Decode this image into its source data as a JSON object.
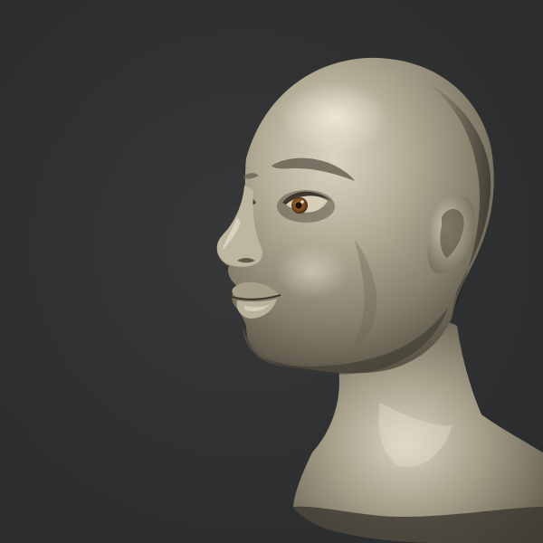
{
  "scene": {
    "subject": "sculpted-head-render",
    "colors": {
      "background": "#2e2f31",
      "skin_base": "#a49d88",
      "skin_highlight": "#e4dfcf",
      "skin_shadow": "#4f4a3f",
      "iris": "#7a4a1e",
      "pupil": "#1a1008",
      "brow": "#5d5648"
    }
  }
}
